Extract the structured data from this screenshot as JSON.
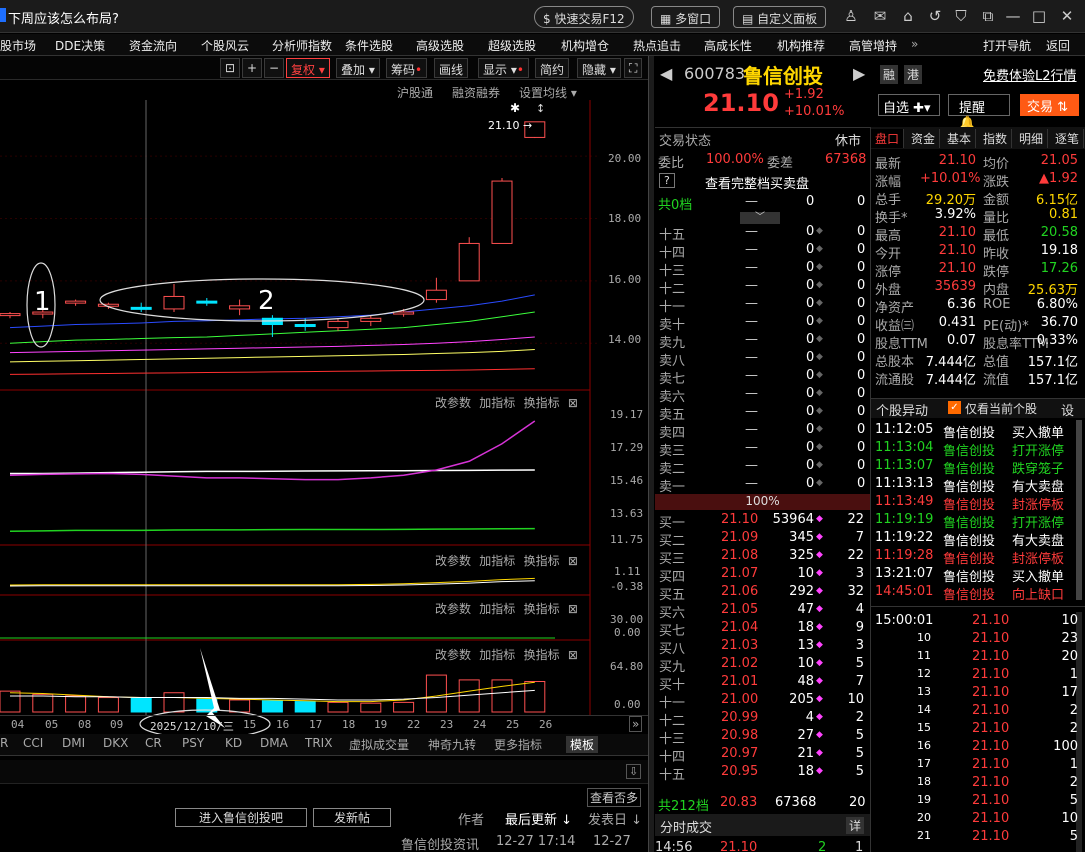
{
  "title": "下周应该怎么布局?",
  "top_buttons": {
    "quick_trade": "快速交易F12",
    "multi_window": "多窗口",
    "custom_panel": "自定义面板"
  },
  "menu": [
    "股市场",
    "DDE决策",
    "资金流向",
    "个股风云",
    "分析师指数",
    "条件选股",
    "高级选股",
    "超级选股",
    "机构增仓",
    "热点追击",
    "高成长性",
    "机构推荐",
    "高管增持"
  ],
  "menu_right": {
    "nav": "打开导航",
    "back": "返回",
    "more": "»"
  },
  "chart_toolbar": {
    "fuquan": "复权",
    "overlay": "叠加",
    "chouma": "筹码",
    "huaxian": "画线",
    "display": "显示",
    "jianyue": "简约",
    "hide": "隐藏"
  },
  "chart_sub": {
    "hgt": "沪股通",
    "rzrq": "融资融券",
    "ma": "设置均线"
  },
  "price_axis": [
    "20.00",
    "18.00",
    "16.00",
    "14.00"
  ],
  "last_label": "21.10",
  "annot": {
    "one": "1",
    "two": "2"
  },
  "ind_labels": {
    "change": "改参数",
    "add": "加指标",
    "switch": "换指标"
  },
  "ind1_axis": [
    "19.17",
    "17.29",
    "15.46",
    "13.63",
    "11.75"
  ],
  "ind2_axis": [
    "1.11",
    "-0.38"
  ],
  "ind3_axis": [
    "30.00",
    "0.00"
  ],
  "ind4_axis": [
    "64.80",
    "0.00"
  ],
  "x_dates": [
    "04",
    "05",
    "08",
    "09",
    "2025/12/10/三",
    "15",
    "16",
    "17",
    "18",
    "19",
    "22",
    "23",
    "24",
    "25",
    "26"
  ],
  "ind_tabs": [
    "R",
    "CCI",
    "DMI",
    "DKX",
    "CR",
    "PSY",
    "KD",
    "DMA",
    "TRIX",
    "虚拟成交量",
    "神奇九转",
    "更多指标",
    "模板"
  ],
  "bottom": {
    "view_more": "查看否多",
    "enter_bar": "进入鲁信创投吧",
    "post": "发新帖",
    "author": "作者",
    "latest": "最后更新",
    "publish": "发表日",
    "news": "鲁信创投资讯",
    "t1": "12-27 17:14",
    "t2": "12-27"
  },
  "stock": {
    "code": "600783",
    "name": "鲁信创投",
    "price": "21.10",
    "chg": "+1.92",
    "pct": "+10.01%",
    "rong": "融",
    "gang": "港",
    "l2": "免费体验L2行情",
    "zixuan": "自选",
    "tixing": "提醒",
    "jiaoyi": "交易"
  },
  "trade_status": {
    "label": "交易状态",
    "value": "休市",
    "weibi_label": "委比",
    "weibi": "100.00%",
    "weicha_label": "委差",
    "weicha": "67368",
    "full": "查看完整档买卖盘",
    "q": "?",
    "total0": "共0档",
    "zero": "0"
  },
  "sell_levels": [
    "十五",
    "十四",
    "十三",
    "十二",
    "十一",
    "卖十",
    "卖九",
    "卖八",
    "卖七",
    "卖六",
    "卖五",
    "卖四",
    "卖三",
    "卖二",
    "卖一"
  ],
  "sell_row": {
    "price": "—",
    "vol": "0",
    "cnt": "0"
  },
  "bar100": "100%",
  "buy_rows": [
    [
      "买一",
      "21.10",
      "53964",
      "22"
    ],
    [
      "买二",
      "21.09",
      "345",
      "7"
    ],
    [
      "买三",
      "21.08",
      "325",
      "22"
    ],
    [
      "买四",
      "21.07",
      "10",
      "3"
    ],
    [
      "买五",
      "21.06",
      "292",
      "32"
    ],
    [
      "买六",
      "21.05",
      "47",
      "4"
    ],
    [
      "买七",
      "21.04",
      "18",
      "9"
    ],
    [
      "买八",
      "21.03",
      "13",
      "3"
    ],
    [
      "买九",
      "21.02",
      "10",
      "5"
    ],
    [
      "买十",
      "21.01",
      "48",
      "7"
    ],
    [
      "十一",
      "21.00",
      "205",
      "10"
    ],
    [
      "十二",
      "20.99",
      "4",
      "2"
    ],
    [
      "十三",
      "20.98",
      "27",
      "5"
    ],
    [
      "十四",
      "20.97",
      "21",
      "5"
    ],
    [
      "十五",
      "20.95",
      "18",
      "5"
    ]
  ],
  "buy_total": {
    "label": "共212档",
    "price": "20.83",
    "vol": "67368",
    "cnt": "20"
  },
  "fenshi": {
    "label": "分时成交",
    "detail": "详",
    "time": "14:56",
    "price": "21.10",
    "vol": "2",
    "cnt": "1"
  },
  "tabs_right": [
    "盘口",
    "资金",
    "基本",
    "指数",
    "明细",
    "逐笔"
  ],
  "quote": [
    [
      "最新",
      "21.10",
      "均价",
      "21.05"
    ],
    [
      "涨幅",
      "+10.01%",
      "涨跌",
      "▲1.92"
    ],
    [
      "总手",
      "29.20万",
      "金额",
      "6.15亿"
    ],
    [
      "换手*",
      "3.92%",
      "量比",
      "0.81"
    ],
    [
      "最高",
      "21.10",
      "最低",
      "20.58"
    ],
    [
      "今开",
      "21.10",
      "昨收",
      "19.18"
    ],
    [
      "涨停",
      "21.10",
      "跌停",
      "17.26"
    ],
    [
      "外盘",
      "35639",
      "内盘",
      "25.63万"
    ],
    [
      "净资产",
      "6.36",
      "ROE",
      "6.80%"
    ],
    [
      "收益㈢",
      "0.431",
      "PE(动)*",
      "36.70"
    ],
    [
      "股息TTM",
      "0.07",
      "股息率TTM",
      "0.33%"
    ],
    [
      "总股本",
      "7.444亿",
      "总值",
      "157.1亿"
    ],
    [
      "流通股",
      "7.444亿",
      "流值",
      "157.1亿"
    ]
  ],
  "yidong": {
    "label": "个股异动",
    "only": "仅看当前个股",
    "set": "设"
  },
  "events": [
    [
      "11:12:05",
      "鲁信创投",
      "买入撤单",
      "w"
    ],
    [
      "11:13:04",
      "鲁信创投",
      "打开涨停",
      "g"
    ],
    [
      "11:13:07",
      "鲁信创投",
      "跌穿笼子",
      "g"
    ],
    [
      "11:13:13",
      "鲁信创投",
      "有大卖盘",
      "w"
    ],
    [
      "11:13:49",
      "鲁信创投",
      "封涨停板",
      "r"
    ],
    [
      "11:19:19",
      "鲁信创投",
      "打开涨停",
      "g"
    ],
    [
      "11:19:22",
      "鲁信创投",
      "有大卖盘",
      "w"
    ],
    [
      "11:19:28",
      "鲁信创投",
      "封涨停板",
      "r"
    ],
    [
      "13:21:07",
      "鲁信创投",
      "买入撤单",
      "w"
    ],
    [
      "14:45:01",
      "鲁信创投",
      "向上缺口",
      "r"
    ]
  ],
  "ticks": [
    [
      "15:00:01",
      "21.10",
      "10"
    ],
    [
      "10",
      "21.10",
      "23"
    ],
    [
      "11",
      "21.10",
      "20"
    ],
    [
      "12",
      "21.10",
      "1"
    ],
    [
      "13",
      "21.10",
      "17"
    ],
    [
      "14",
      "21.10",
      "2"
    ],
    [
      "15",
      "21.10",
      "2"
    ],
    [
      "16",
      "21.10",
      "100"
    ],
    [
      "17",
      "21.10",
      "1"
    ],
    [
      "18",
      "21.10",
      "2"
    ],
    [
      "19",
      "21.10",
      "5"
    ],
    [
      "20",
      "21.10",
      "10"
    ],
    [
      "21",
      "21.10",
      "5"
    ]
  ],
  "chart_data": {
    "type": "candlestick",
    "x": [
      "04",
      "05",
      "08",
      "09",
      "10",
      "11",
      "12",
      "15",
      "16",
      "17",
      "18",
      "19",
      "22",
      "23",
      "24",
      "25",
      "26"
    ],
    "ohlc": [
      [
        14.9,
        15.0,
        14.8,
        14.95
      ],
      [
        14.95,
        15.1,
        14.8,
        15.0
      ],
      [
        15.3,
        15.4,
        15.2,
        15.35
      ],
      [
        15.2,
        15.3,
        15.1,
        15.25
      ],
      [
        15.15,
        15.3,
        15.0,
        15.1
      ],
      [
        15.1,
        15.9,
        15.0,
        15.5
      ],
      [
        15.35,
        15.45,
        15.2,
        15.3
      ],
      [
        15.1,
        15.4,
        14.9,
        15.2
      ],
      [
        14.8,
        14.9,
        14.2,
        14.6
      ],
      [
        14.6,
        14.8,
        14.4,
        14.55
      ],
      [
        14.5,
        14.8,
        14.4,
        14.7
      ],
      [
        14.7,
        14.9,
        14.55,
        14.8
      ],
      [
        14.95,
        15.1,
        14.85,
        15.0
      ],
      [
        15.4,
        16.1,
        15.3,
        15.7
      ],
      [
        16.0,
        17.4,
        16.0,
        17.2
      ],
      [
        17.2,
        19.3,
        18.0,
        19.2
      ],
      [
        20.6,
        21.1,
        20.58,
        21.1
      ]
    ],
    "ylim": [
      12.5,
      21.8
    ],
    "volume": [
      26,
      22,
      20,
      18,
      17,
      24,
      16,
      15,
      14,
      13,
      12,
      11,
      12,
      46,
      40,
      40,
      38
    ],
    "vol_ylim": [
      0,
      64.8
    ]
  }
}
